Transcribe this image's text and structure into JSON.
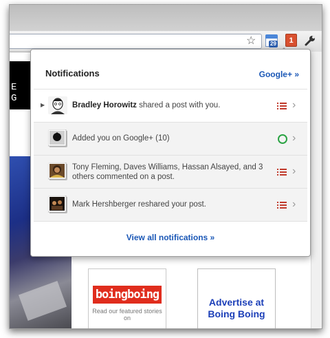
{
  "toolbar": {
    "calendar_badge": "29",
    "notification_count": "1"
  },
  "background": {
    "header_letters": "E G",
    "ad1_logo": "boingboing",
    "ad1_sub": "Read our featured stories on",
    "ad2_text": "Advertise at Boing Boing"
  },
  "panel": {
    "title": "Notifications",
    "gplus_link": "Google+ »",
    "items": [
      {
        "actor": "Bradley Horowitz",
        "text": " shared a post with you.",
        "icon": "list-icon"
      },
      {
        "actor": "",
        "text": "Added you on Google+ (10)",
        "icon": "circle-icon"
      },
      {
        "actor": "",
        "text": "Tony Fleming, Daves Williams, Hassan Alsayed, and 3 others commented on a post.",
        "icon": "list-icon"
      },
      {
        "actor": "",
        "text": "Mark Hershberger reshared your post.",
        "icon": "list-icon"
      }
    ],
    "view_all": "View all notifications »"
  },
  "colors": {
    "link": "#1a57b6",
    "notification_badge": "#d9502f",
    "circle_icon": "#2aa343",
    "list_icon": "#c0392b"
  }
}
